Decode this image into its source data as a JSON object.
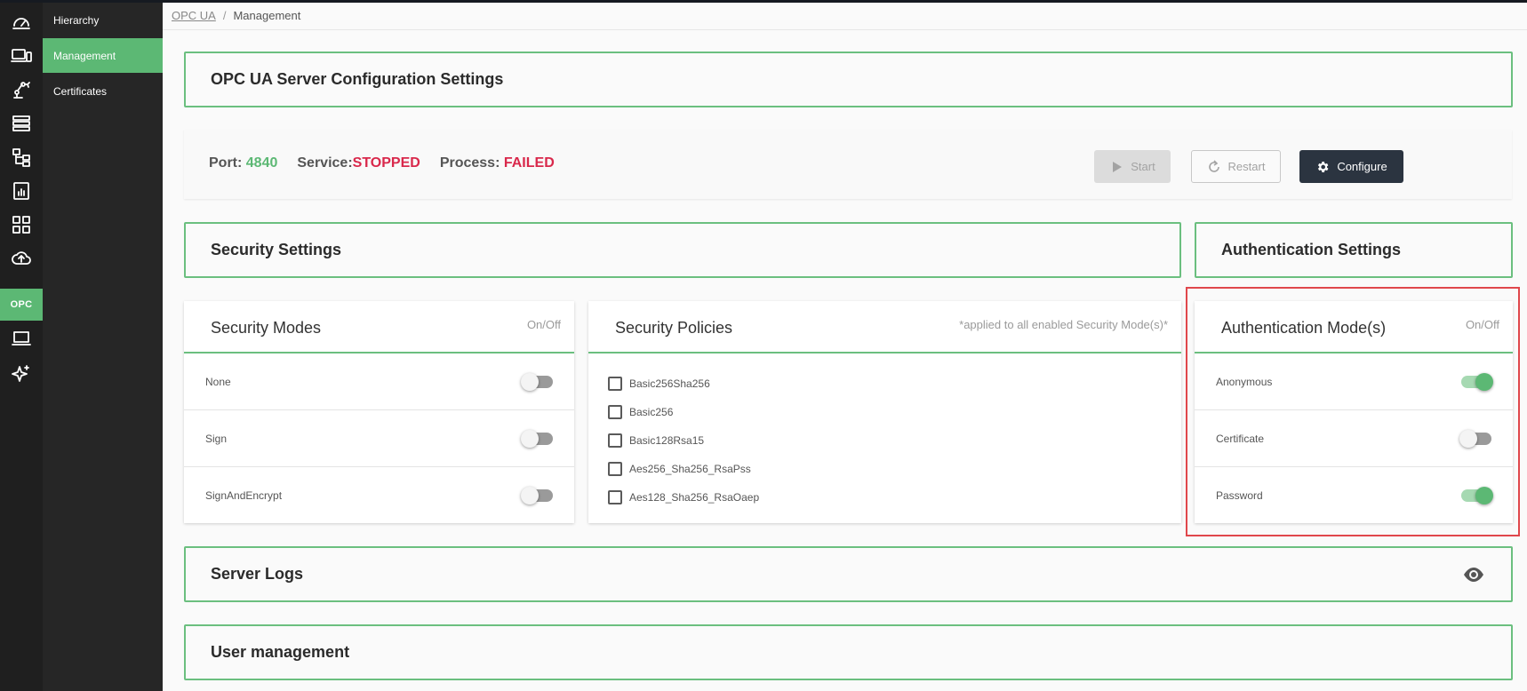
{
  "rail": {
    "items": [
      {
        "name": "dashboard-icon"
      },
      {
        "name": "devices-icon"
      },
      {
        "name": "robot-arm-icon"
      },
      {
        "name": "storage-list-icon"
      },
      {
        "name": "hierarchy-tree-icon"
      },
      {
        "name": "chart-icon"
      },
      {
        "name": "apps-grid-icon"
      },
      {
        "name": "cloud-upload-icon"
      },
      {
        "name": "opc-icon",
        "label": "OPC"
      },
      {
        "name": "laptop-icon"
      },
      {
        "name": "sparkle-icon"
      }
    ]
  },
  "subnav": {
    "items": [
      {
        "label": "Hierarchy"
      },
      {
        "label": "Management"
      },
      {
        "label": "Certificates"
      }
    ],
    "active_index": 1
  },
  "breadcrumb": {
    "link": "OPC UA",
    "separator": "/",
    "current": "Management"
  },
  "server_config": {
    "title": "OPC UA Server Configuration Settings"
  },
  "status": {
    "port_label": "Port:",
    "port_value": "4840",
    "service_label": "Service:",
    "service_value": "STOPPED",
    "process_label": "Process:",
    "process_value": "FAILED",
    "start_label": "Start",
    "restart_label": "Restart",
    "configure_label": "Configure"
  },
  "security_settings": {
    "title": "Security Settings"
  },
  "authentication_settings": {
    "title": "Authentication Settings"
  },
  "security_modes": {
    "title": "Security Modes",
    "subtitle": "On/Off",
    "items": [
      {
        "label": "None",
        "on": false
      },
      {
        "label": "Sign",
        "on": false
      },
      {
        "label": "SignAndEncrypt",
        "on": false
      }
    ]
  },
  "security_policies": {
    "title": "Security Policies",
    "subtitle": "*applied to all enabled Security Mode(s)*",
    "items": [
      {
        "label": "Basic256Sha256",
        "checked": false
      },
      {
        "label": "Basic256",
        "checked": false
      },
      {
        "label": "Basic128Rsa15",
        "checked": false
      },
      {
        "label": "Aes256_Sha256_RsaPss",
        "checked": false
      },
      {
        "label": "Aes128_Sha256_RsaOaep",
        "checked": false
      }
    ]
  },
  "auth_modes": {
    "title": "Authentication Mode(s)",
    "subtitle": "On/Off",
    "items": [
      {
        "label": "Anonymous",
        "on": true
      },
      {
        "label": "Certificate",
        "on": false
      },
      {
        "label": "Password",
        "on": true
      }
    ]
  },
  "server_logs": {
    "title": "Server Logs",
    "icon": "eye-icon"
  },
  "user_management": {
    "title": "User management"
  },
  "colors": {
    "accent": "#5cb874",
    "error": "#d9284b",
    "highlight": "#e0474c",
    "dark_button": "#2b3440"
  }
}
